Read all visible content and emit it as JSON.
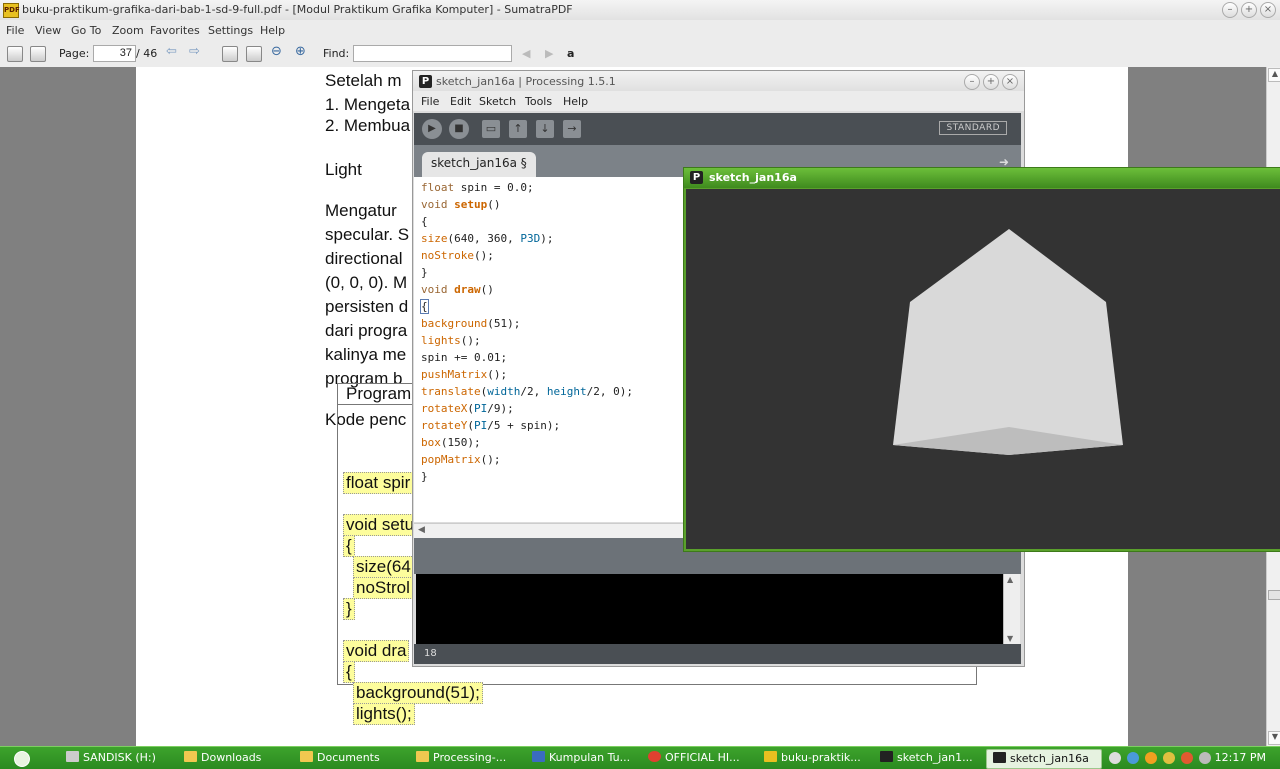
{
  "sumatra": {
    "title": "buku-praktikum-grafika-dari-bab-1-sd-9-full.pdf - [Modul Praktikum Grafika Komputer] - SumatraPDF",
    "menu": [
      "File",
      "View",
      "Go To",
      "Zoom",
      "Favorites",
      "Settings",
      "Help"
    ],
    "toolbar": {
      "page_label": "Page:",
      "page_value": "37",
      "page_total": "/ 46",
      "find_label": "Find:",
      "find_value": ""
    },
    "doc": {
      "lines": [
        "Setelah m",
        "1. Mengeta",
        "2. Membua",
        "Light",
        "Mengatur",
        "specular. S",
        "directional",
        "(0, 0, 0). M",
        "persisten d",
        "dari progra",
        "kalinya me",
        "program b",
        "Kode penc"
      ],
      "box_header": "Program",
      "code_lines": [
        "float spir",
        "void setu",
        "{",
        "size(64",
        "noStrol",
        "}",
        "void dra",
        "{",
        "background(51);",
        "lights();"
      ]
    }
  },
  "ide": {
    "title": "sketch_jan16a | Processing 1.5.1",
    "menu": [
      "File",
      "Edit",
      "Sketch",
      "Tools",
      "Help"
    ],
    "mode": "STANDARD",
    "tab": "sketch_jan16a §",
    "line_number": "18"
  },
  "sketch": {
    "title": "sketch_jan16a"
  },
  "taskbar": {
    "tasks": [
      "SANDISK (H:)",
      "Downloads",
      "Documents",
      "Processing-...",
      "Kumpulan Tu...",
      "OFFICIAL HI...",
      "buku-praktik...",
      "sketch_jan1...",
      "sketch_jan16a"
    ],
    "clock": "12:17 PM"
  },
  "colors": {
    "keyword": "#996633",
    "function": "#cc6600",
    "constant": "#006699",
    "sketch_bg": "#333333",
    "taskbar": "#2b8a20"
  }
}
